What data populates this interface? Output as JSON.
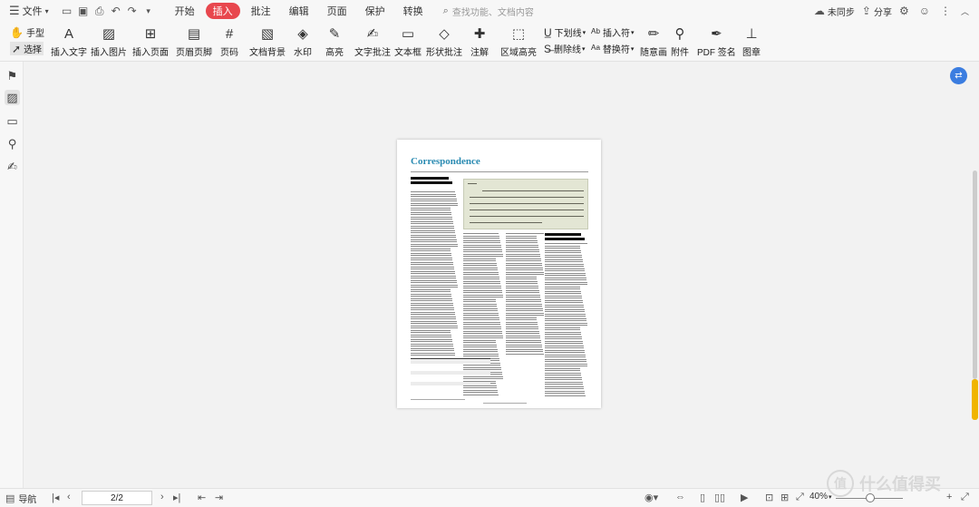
{
  "topbar": {
    "file_menu": "文件",
    "tabs": [
      "开始",
      "插入",
      "批注",
      "编辑",
      "页面",
      "保护",
      "转换"
    ],
    "active_tab": "插入",
    "search_placeholder": "查找功能、文档内容",
    "sync": "未同步",
    "share": "分享"
  },
  "ribbon": {
    "hand_tool": "手型",
    "select_tool": "选择",
    "buttons": [
      "插入文字",
      "插入图片",
      "插入页面",
      "页眉页脚",
      "页码",
      "文档背景",
      "水印",
      "高亮",
      "文字批注",
      "文本框",
      "形状批注",
      "注解",
      "区域高亮"
    ],
    "underline": "下划线",
    "strikethrough": "删除线",
    "insert_mark": "插入符",
    "replace_mark": "替换符",
    "freehand": "随意画",
    "attachment": "附件",
    "pdf_sign": "PDF 签名",
    "stamp": "图章"
  },
  "document": {
    "page_title": "Correspondence"
  },
  "statusbar": {
    "navigation": "导航",
    "page_indicator": "2/2",
    "zoom": "40%"
  },
  "watermark": "什么值得买"
}
